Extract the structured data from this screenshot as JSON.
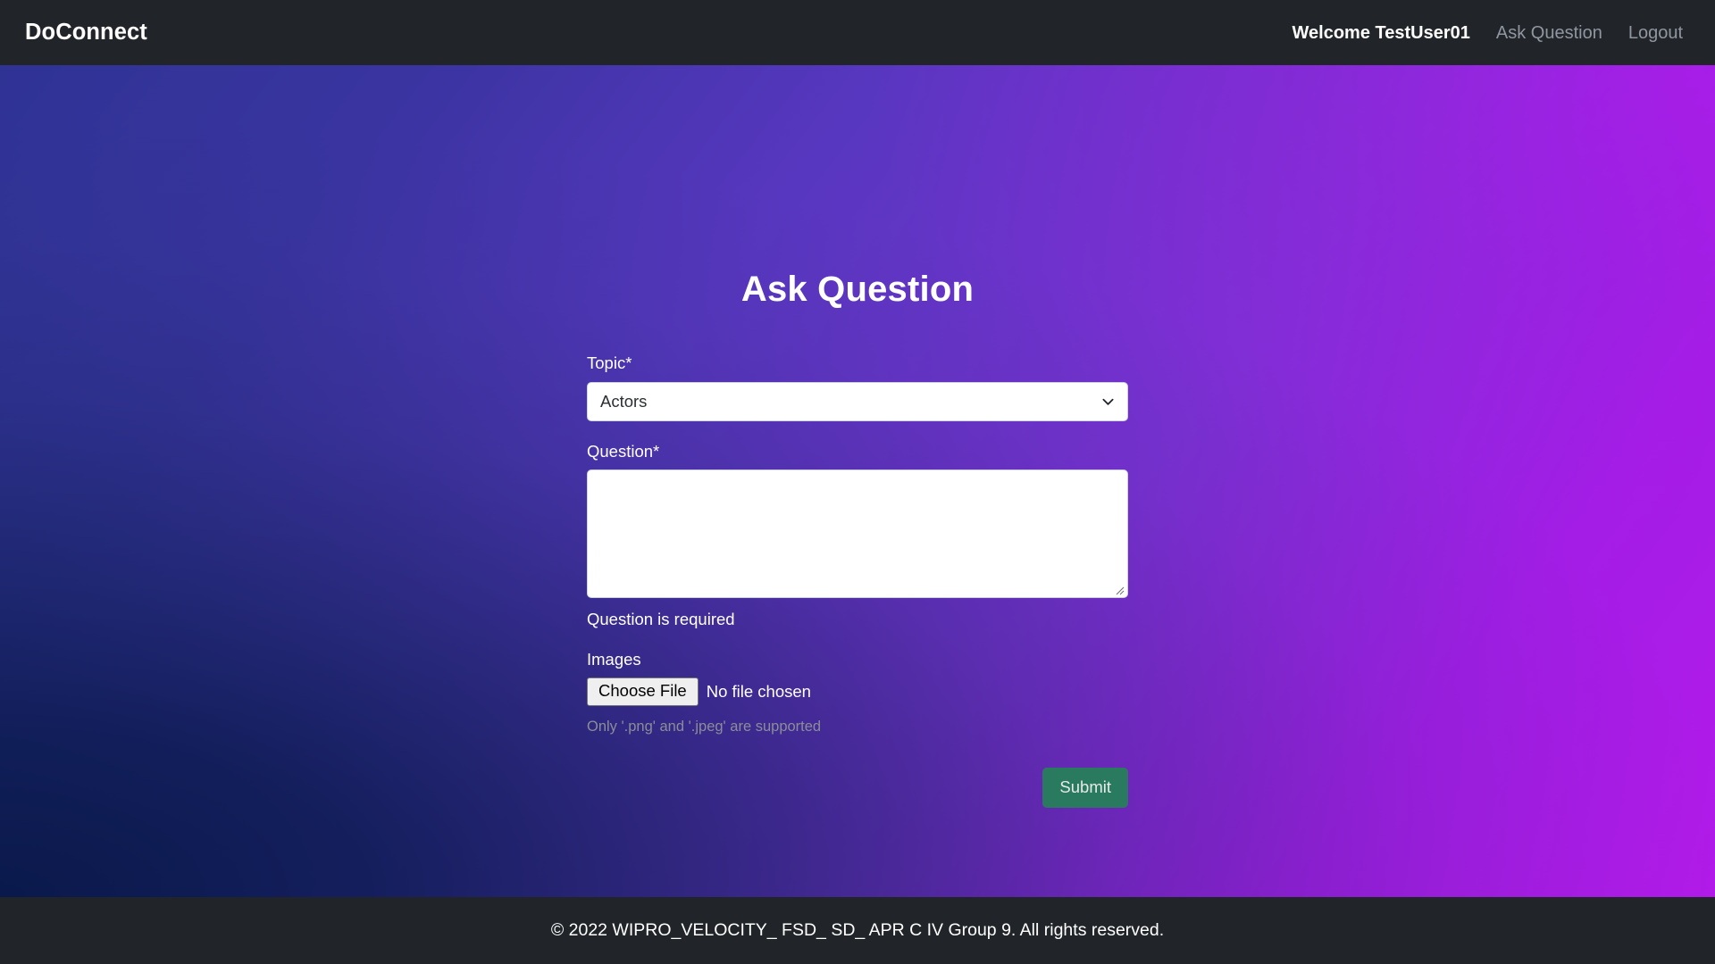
{
  "navbar": {
    "brand": "DoConnect",
    "welcome": "Welcome TestUser01",
    "links": [
      {
        "label": "Ask Question",
        "name": "ask-question"
      },
      {
        "label": "Logout",
        "name": "logout"
      }
    ],
    "ask_question_label": "Ask Question",
    "logout_label": "Logout",
    "background_color": "#212529",
    "link_color": "#9096a0"
  },
  "page": {
    "title": "Ask Question",
    "gradient_from": "#2f3394",
    "gradient_to": "#b41aea",
    "gradient_corner_bottom_left": "#0e2050"
  },
  "form": {
    "topic": {
      "label": "Topic*",
      "selected": "Actors",
      "icon": "chevron-down-icon"
    },
    "question": {
      "label": "Question*",
      "value": "",
      "placeholder": "",
      "error": "Question is required"
    },
    "images": {
      "label": "Images",
      "choose_file_label": "Choose File",
      "file_status": "No file chosen",
      "helper": "Only '.png' and '.jpeg' are supported"
    },
    "submit": {
      "label": "Submit",
      "color": "#2a7a60"
    }
  },
  "footer": {
    "text": "© 2022 WIPRO_VELOCITY_ FSD_ SD_ APR C IV Group 9. All rights reserved.",
    "background_color": "#212529"
  }
}
